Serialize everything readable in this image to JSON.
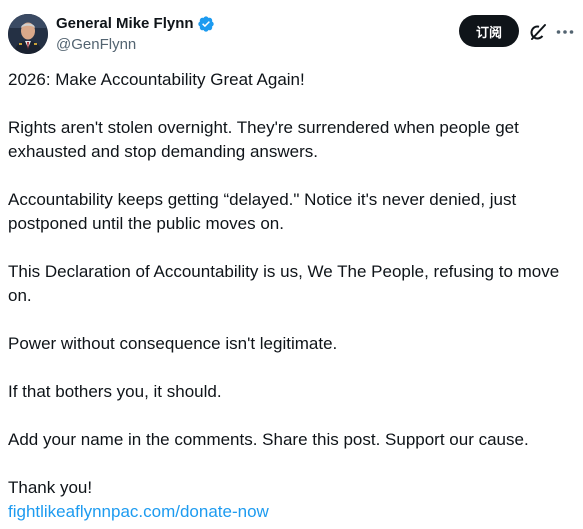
{
  "author": {
    "display_name": "General Mike Flynn",
    "handle": "@GenFlynn",
    "verified_icon": "verified-badge-icon",
    "avatar_icon": "profile-photo"
  },
  "actions": {
    "subscribe_label": "订阅",
    "grok_icon": "grok-icon",
    "more_icon": "more-horizontal-icon"
  },
  "post": {
    "paragraphs": [
      "2026: Make Accountability Great Again!",
      "Rights aren't stolen overnight. They're surrendered when people get exhausted and stop demanding answers.",
      "Accountability keeps getting “delayed.\" Notice it's never denied, just postponed until the public moves on.",
      "This Declaration of Accountability is us, We The People, refusing to move on.",
      "Power without consequence isn't legitimate.",
      "If that bothers you, it should.",
      "Add your name in the comments. Share this post. Support our cause.",
      "Thank you!"
    ],
    "link_text": "fightlikeaflynnpac.com/donate-now"
  },
  "colors": {
    "accent": "#1d9bf0",
    "text": "#0f1419",
    "secondary": "#536471",
    "button_bg": "#0f1419"
  }
}
